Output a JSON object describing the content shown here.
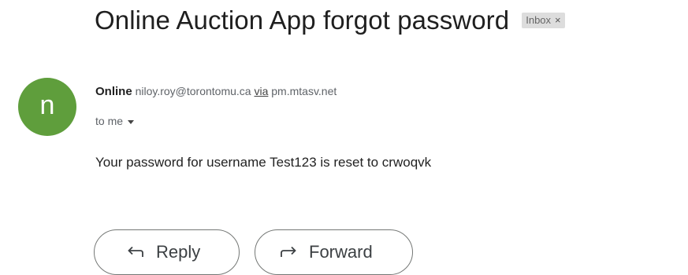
{
  "email": {
    "subject": "Online Auction App forgot password",
    "label": "Inbox",
    "label_close": "×",
    "avatar_letter": "n",
    "sender_name": "Online",
    "sender_email": "niloy.roy@torontomu.ca",
    "via_text": "via",
    "via_domain": "pm.mtasv.net",
    "recipient": "to me",
    "body": "Your password for username Test123 is reset to crwoqvk"
  },
  "actions": {
    "reply_label": "Reply",
    "forward_label": "Forward"
  },
  "icons": {
    "reply": "reply-arrow-icon",
    "forward": "forward-arrow-icon",
    "recipient_details": "chevron-down-icon"
  },
  "colors": {
    "avatar": "#5f9e3c",
    "label_chip": "#dddddd"
  }
}
